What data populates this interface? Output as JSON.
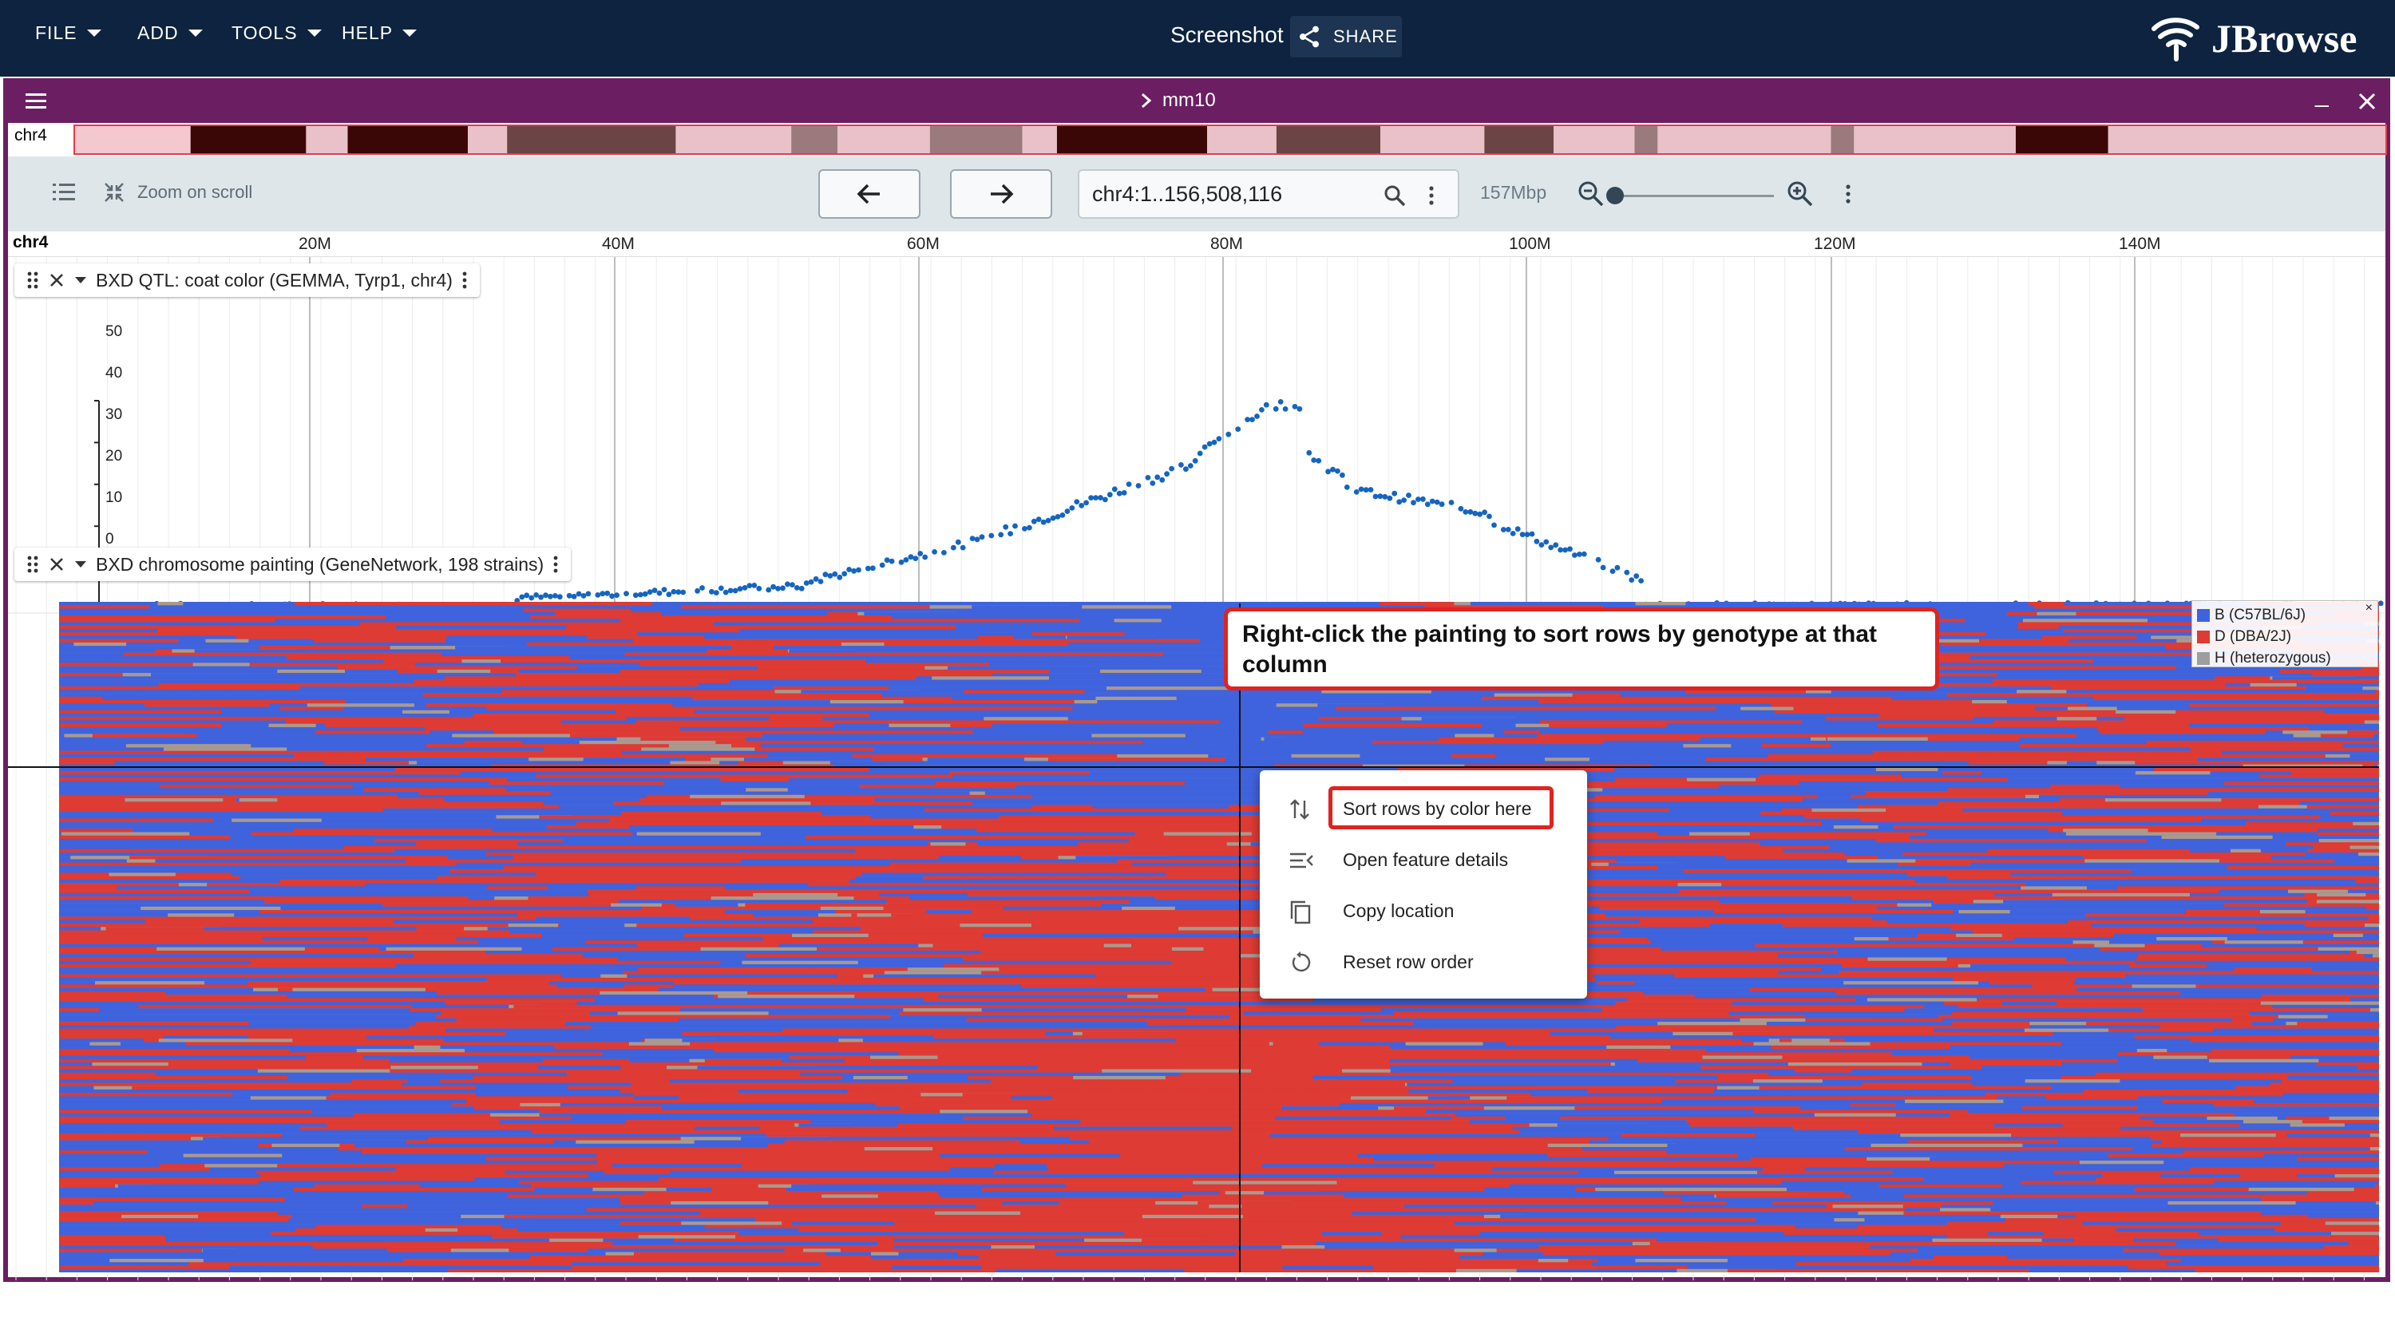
{
  "menubar": {
    "items": [
      {
        "label": "FILE"
      },
      {
        "label": "ADD"
      },
      {
        "label": "TOOLS"
      },
      {
        "label": "HELP"
      }
    ],
    "session_name": "Screenshot",
    "share_label": "SHARE",
    "logo_text": "JBrowse"
  },
  "view": {
    "assembly": "mm10",
    "overview_chrom": "chr4",
    "zoom_on_scroll_label": "Zoom on scroll",
    "location": "chr4:1..156,508,116",
    "bp_per_px_label": "157Mbp",
    "zoom_level": 0.0,
    "ruler": {
      "chrom": "chr4",
      "ticks": [
        "20M",
        "40M",
        "60M",
        "80M",
        "100M",
        "120M",
        "140M"
      ]
    }
  },
  "tracks": {
    "qtl": {
      "name": "BXD QTL: coat color (GEMMA, Tyrp1, chr4)",
      "y_ticks": [
        "50",
        "40",
        "30",
        "20",
        "10",
        "0"
      ],
      "color": "#1565c0"
    },
    "painting": {
      "name": "BXD chromosome painting (GeneNetwork, 198 strains)",
      "legend": [
        {
          "label": "B (C57BL/6J)",
          "color": "#3f63dc"
        },
        {
          "label": "D (DBA/2J)",
          "color": "#dd3b34"
        },
        {
          "label": "H (heterozygous)",
          "color": "#9e9e9e"
        }
      ],
      "legend_close": "×"
    }
  },
  "callout": {
    "text": "Right-click the painting to sort rows by genotype at that column"
  },
  "context_menu": {
    "items": [
      {
        "label": "Sort rows by color here",
        "icon": "sort-icon"
      },
      {
        "label": "Open feature details",
        "icon": "details-icon"
      },
      {
        "label": "Copy location",
        "icon": "copy-icon"
      },
      {
        "label": "Reset row order",
        "icon": "reset-icon"
      }
    ]
  },
  "colors": {
    "appbar": "#0d233f",
    "view_header": "#6b1f62",
    "highlight": "#df2320"
  }
}
